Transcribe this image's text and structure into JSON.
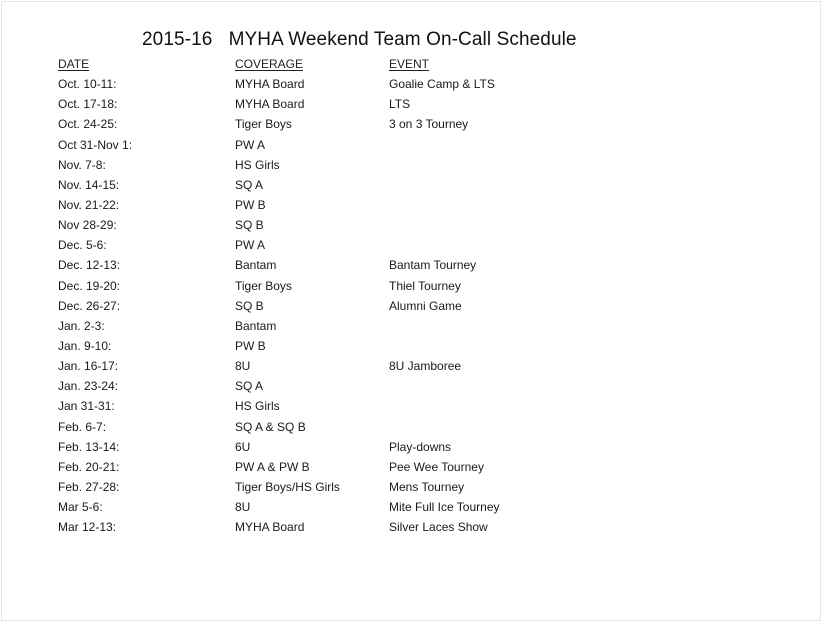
{
  "document": {
    "title": "2015-16   MYHA Weekend Team On-Call Schedule",
    "headers": {
      "date": "DATE",
      "coverage": "COVERAGE",
      "event": "EVENT"
    },
    "rows": [
      {
        "date": "Oct. 10-11:",
        "coverage": "MYHA Board",
        "event": "Goalie Camp & LTS"
      },
      {
        "date": "Oct. 17-18:",
        "coverage": "MYHA Board",
        "event": "LTS"
      },
      {
        "date": "Oct. 24-25:",
        "coverage": "Tiger Boys",
        "event": "3 on 3 Tourney"
      },
      {
        "date": "Oct 31-Nov 1:",
        "coverage": "PW A",
        "event": ""
      },
      {
        "date": "Nov. 7-8:",
        "coverage": "HS Girls",
        "event": ""
      },
      {
        "date": "Nov. 14-15:",
        "coverage": "SQ A",
        "event": ""
      },
      {
        "date": "Nov. 21-22:",
        "coverage": "PW B",
        "event": ""
      },
      {
        "date": "Nov 28-29:",
        "coverage": "SQ B",
        "event": ""
      },
      {
        "date": "Dec. 5-6:",
        "coverage": "PW A",
        "event": ""
      },
      {
        "date": "Dec. 12-13:",
        "coverage": "Bantam",
        "event": "Bantam Tourney"
      },
      {
        "date": "Dec. 19-20:",
        "coverage": "Tiger Boys",
        "event": "Thiel Tourney"
      },
      {
        "date": "Dec. 26-27:",
        "coverage": "SQ B",
        "event": "Alumni Game"
      },
      {
        "date": "Jan. 2-3:",
        "coverage": "Bantam",
        "event": ""
      },
      {
        "date": "Jan. 9-10:",
        "coverage": "PW B",
        "event": ""
      },
      {
        "date": "Jan. 16-17:",
        "coverage": "8U",
        "event": "8U Jamboree"
      },
      {
        "date": "Jan. 23-24:",
        "coverage": "SQ A",
        "event": ""
      },
      {
        "date": "Jan 31-31:",
        "coverage": "HS Girls",
        "event": ""
      },
      {
        "date": "Feb. 6-7:",
        "coverage": "SQ A & SQ B",
        "event": ""
      },
      {
        "date": "Feb. 13-14:",
        "coverage": "6U",
        "event": "Play-downs"
      },
      {
        "date": "Feb. 20-21:",
        "coverage": "PW A & PW B",
        "event": "Pee Wee Tourney"
      },
      {
        "date": "Feb. 27-28:",
        "coverage": "Tiger Boys/HS Girls",
        "event": "Mens Tourney"
      },
      {
        "date": "Mar 5-6:",
        "coverage": "8U",
        "event": "Mite Full Ice Tourney"
      },
      {
        "date": "Mar 12-13:",
        "coverage": "MYHA Board",
        "event": "Silver Laces Show"
      }
    ]
  }
}
